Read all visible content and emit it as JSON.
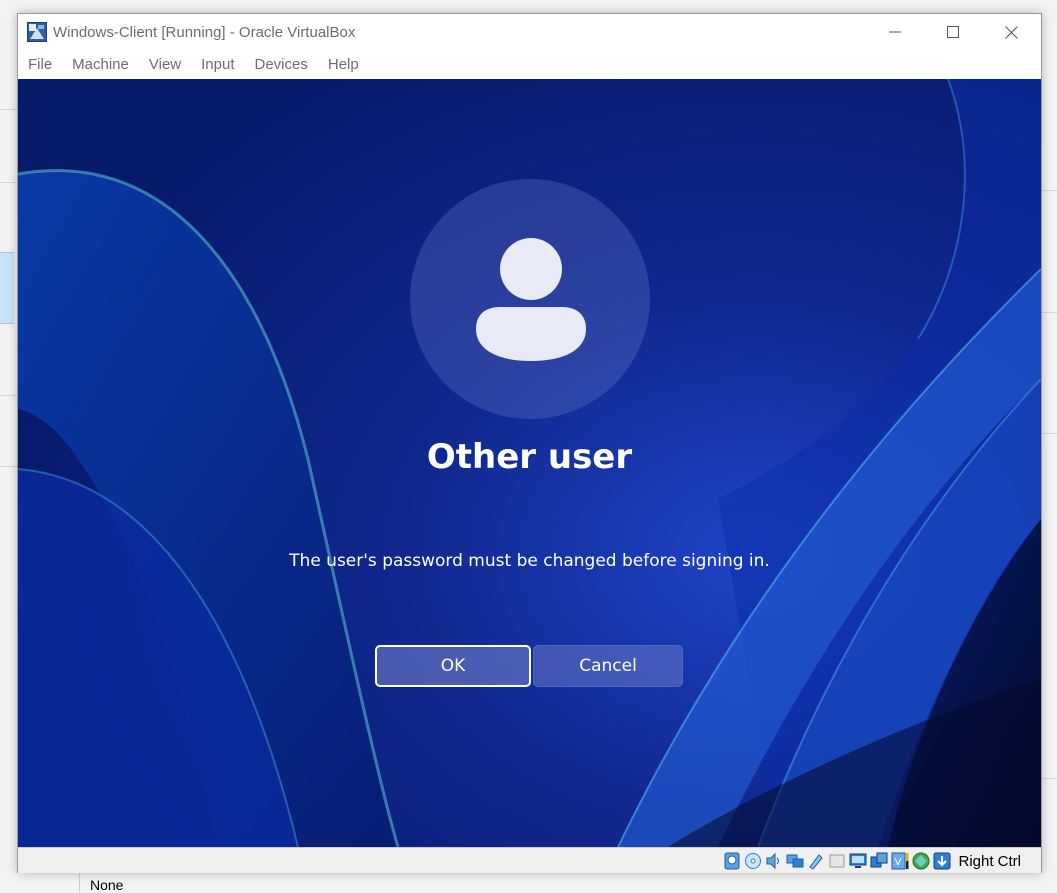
{
  "window": {
    "title": "Windows-Client [Running] - Oracle VirtualBox"
  },
  "menu": {
    "items": [
      {
        "label": "File"
      },
      {
        "label": "Machine"
      },
      {
        "label": "View"
      },
      {
        "label": "Input"
      },
      {
        "label": "Devices"
      },
      {
        "label": "Help"
      }
    ]
  },
  "login": {
    "user_name": "Other user",
    "message": "The user's password must be changed before signing in.",
    "ok_label": "OK",
    "cancel_label": "Cancel"
  },
  "statusbar": {
    "icons": [
      "hard-disk-icon",
      "optical-drive-icon",
      "audio-icon",
      "network-icon",
      "usb-icon",
      "shared-folders-icon",
      "display-icon",
      "recording-icon",
      "virtualization-icon",
      "guest-additions-icon",
      "mouse-integration-icon"
    ],
    "host_key": "Right Ctrl"
  },
  "host_background": {
    "bottom_text": "None"
  },
  "colors": {
    "vm_background": "#0f2a9a",
    "button_fill": "#7887cd"
  }
}
